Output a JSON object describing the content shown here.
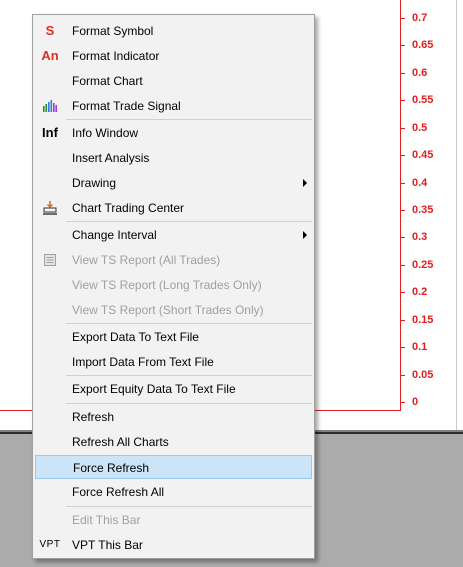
{
  "price_axis": {
    "labels": [
      "0.7",
      "0.65",
      "0.6",
      "0.55",
      "0.5",
      "0.45",
      "0.4",
      "0.35",
      "0.3",
      "0.25",
      "0.2",
      "0.15",
      "0.1",
      "0.05",
      "0"
    ]
  },
  "colors": {
    "axis": "#e02020",
    "menu_background": "#f2f2f2",
    "highlight": "#cce4f7",
    "disabled_text": "#a0a0a0"
  },
  "menu": {
    "items": [
      {
        "label": "Format Symbol",
        "icon": "format-symbol-icon",
        "icon_text": "S"
      },
      {
        "label": "Format Indicator",
        "icon": "format-indicator-icon",
        "icon_text": "An"
      },
      {
        "label": "Format Chart"
      },
      {
        "label": "Format Trade Signal",
        "icon": "trade-signal-bars-icon"
      },
      {
        "label": "Info Window",
        "icon": "info-window-icon",
        "icon_text": "Inf"
      },
      {
        "label": "Insert Analysis"
      },
      {
        "label": "Drawing",
        "submenu": true
      },
      {
        "label": "Chart Trading Center",
        "icon": "trading-center-icon"
      },
      {
        "label": "Change Interval",
        "submenu": true
      },
      {
        "label": "View TS Report (All Trades)",
        "disabled": true,
        "icon": "report-icon"
      },
      {
        "label": "View TS Report (Long Trades Only)",
        "disabled": true
      },
      {
        "label": "View TS Report (Short Trades Only)",
        "disabled": true
      },
      {
        "label": "Export Data To Text File"
      },
      {
        "label": "Import Data From Text File"
      },
      {
        "label": "Export Equity Data To Text File"
      },
      {
        "label": "Refresh"
      },
      {
        "label": "Refresh All Charts"
      },
      {
        "label": "Force Refresh",
        "highlighted": true
      },
      {
        "label": "Force Refresh All"
      },
      {
        "label": "Edit This Bar",
        "disabled": true
      },
      {
        "label": "VPT This Bar",
        "icon": "vpt-icon",
        "icon_text": "VPT"
      }
    ]
  }
}
